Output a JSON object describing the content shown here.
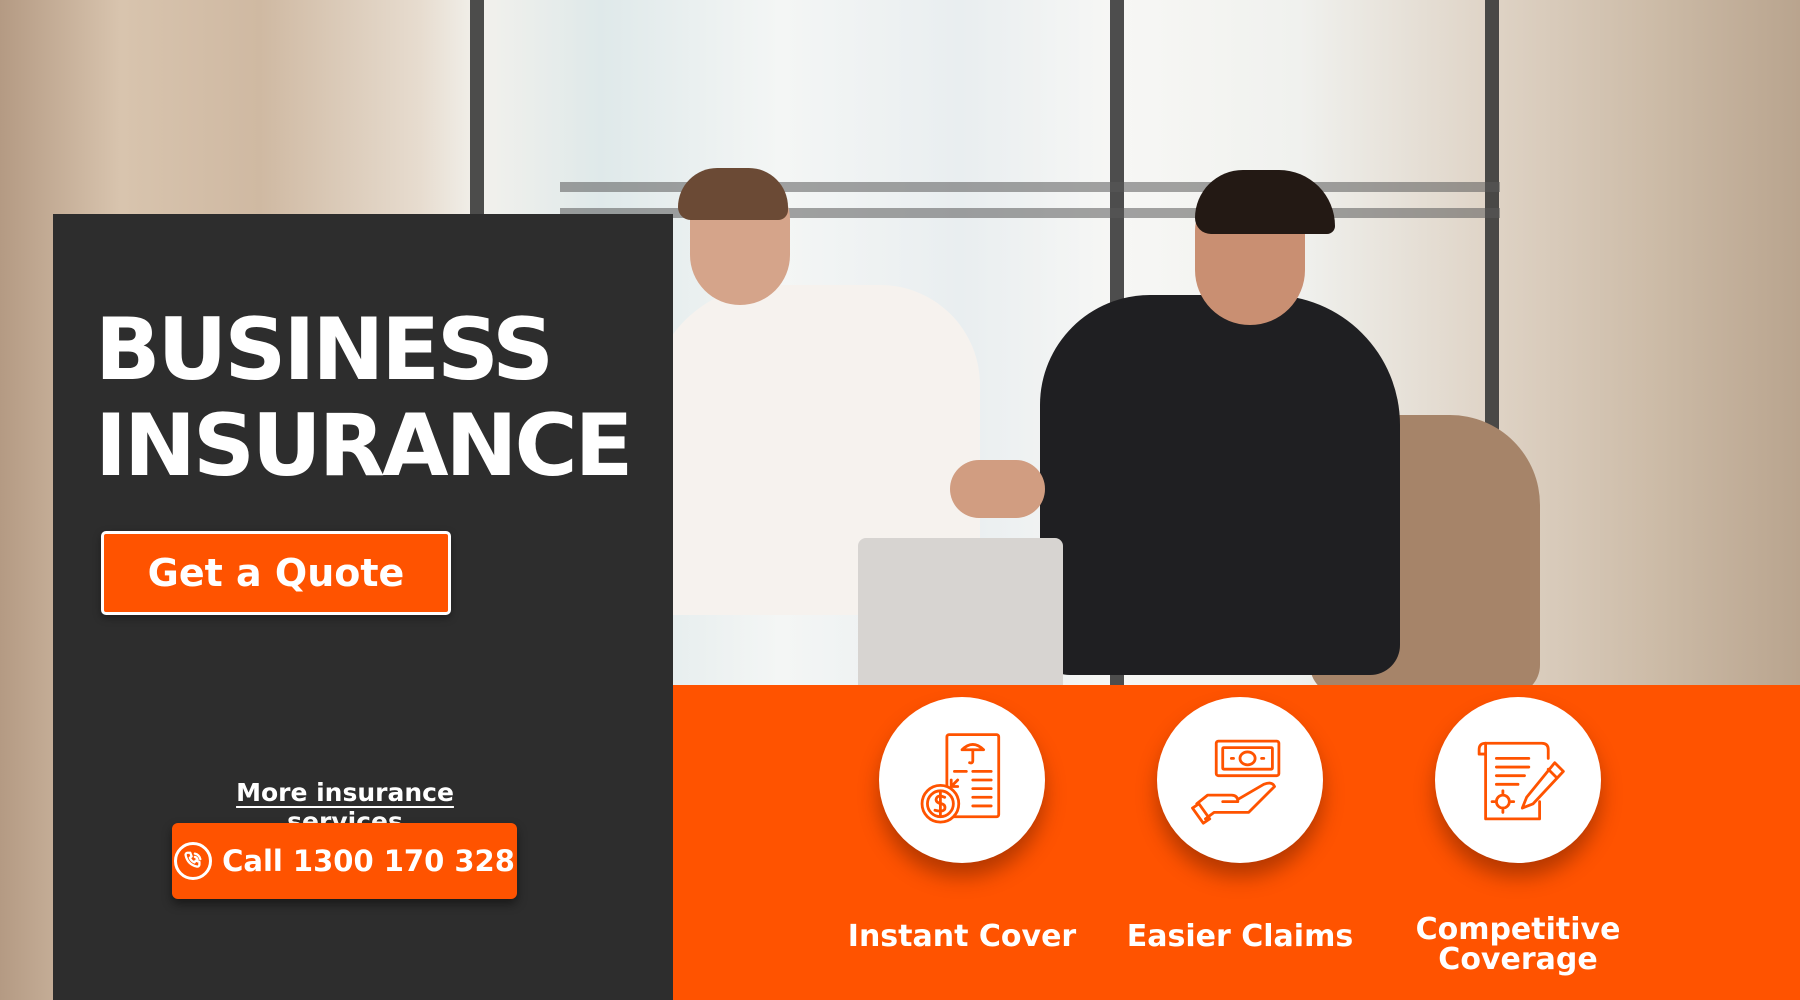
{
  "hero": {
    "headline_line1": "BUSINESS",
    "headline_line2": "INSURANCE",
    "quote_button_label": "Get a Quote",
    "more_services_link": "More insurance services",
    "call_button_label": "Call 1300 170 328"
  },
  "features": [
    {
      "label": "Instant Cover",
      "icon": "document-umbrella-dollar-icon"
    },
    {
      "label": "Easier Claims",
      "icon": "hand-money-icon"
    },
    {
      "label": "Competitive",
      "label_line2": "Coverage",
      "icon": "contract-pen-icon"
    }
  ],
  "colors": {
    "accent": "#ff5300",
    "panel": "#2d2d2d",
    "text_light": "#ffffff"
  },
  "icons": {
    "phone": "phone-call-icon"
  }
}
